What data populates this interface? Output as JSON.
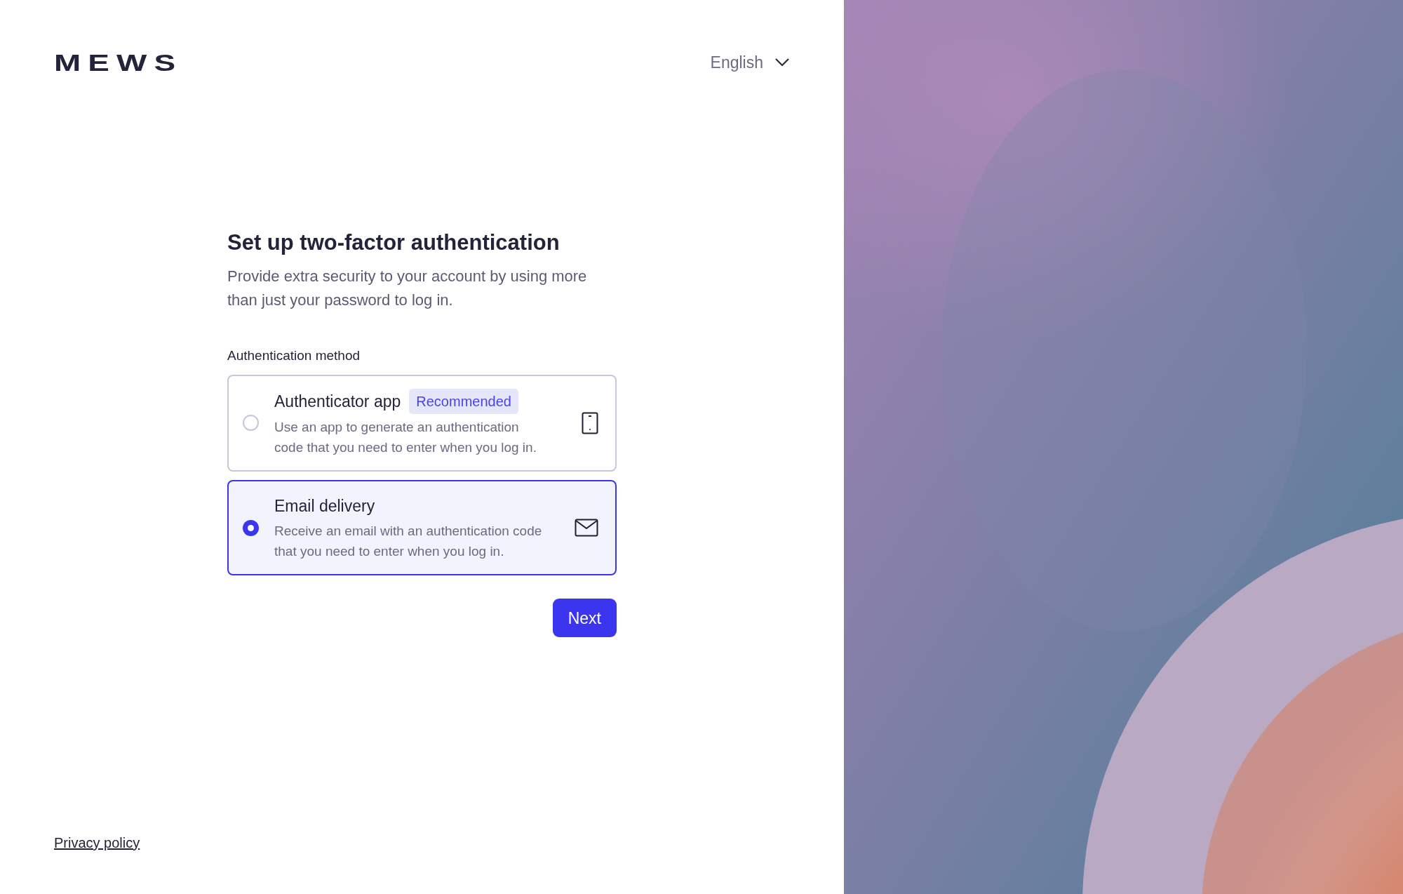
{
  "logo": "MEWS",
  "language": {
    "label": "English"
  },
  "title": "Set up two-factor authentication",
  "subtitle": "Provide extra security to your account by using more than just your password to log in.",
  "method_label": "Authentication method",
  "options": [
    {
      "kind": "phone",
      "title": "Authenticator app",
      "badge": "Recommended",
      "description": "Use an app to generate an authentication code that you need to enter when you log in.",
      "selected": false
    },
    {
      "kind": "mail",
      "title": "Email delivery",
      "description": "Receive an email with an authentication code that you need to enter when you log in.",
      "selected": true
    }
  ],
  "next_button": "Next",
  "footer_link": "Privacy policy"
}
